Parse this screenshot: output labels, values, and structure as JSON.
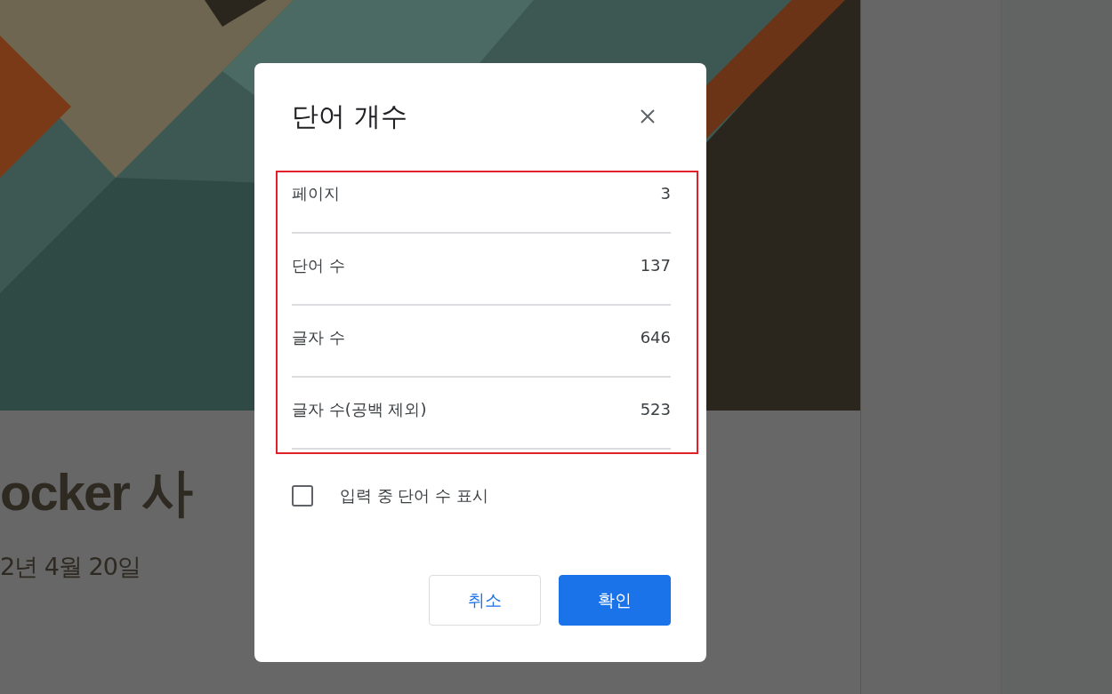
{
  "document": {
    "title": "ocker 사",
    "date": "2년 4월 20일"
  },
  "dialog": {
    "title": "단어 개수",
    "stats_highlighted": true,
    "stats": [
      {
        "label": "페이지",
        "value": "3"
      },
      {
        "label": "단어 수",
        "value": "137"
      },
      {
        "label": "글자 수",
        "value": "646"
      },
      {
        "label": "글자 수(공백 제외)",
        "value": "523"
      }
    ],
    "option": {
      "label": "입력 중 단어 수 표시",
      "checked": false
    },
    "buttons": [
      {
        "label": "취소",
        "kind": "secondary"
      },
      {
        "label": "확인",
        "kind": "primary"
      }
    ]
  }
}
